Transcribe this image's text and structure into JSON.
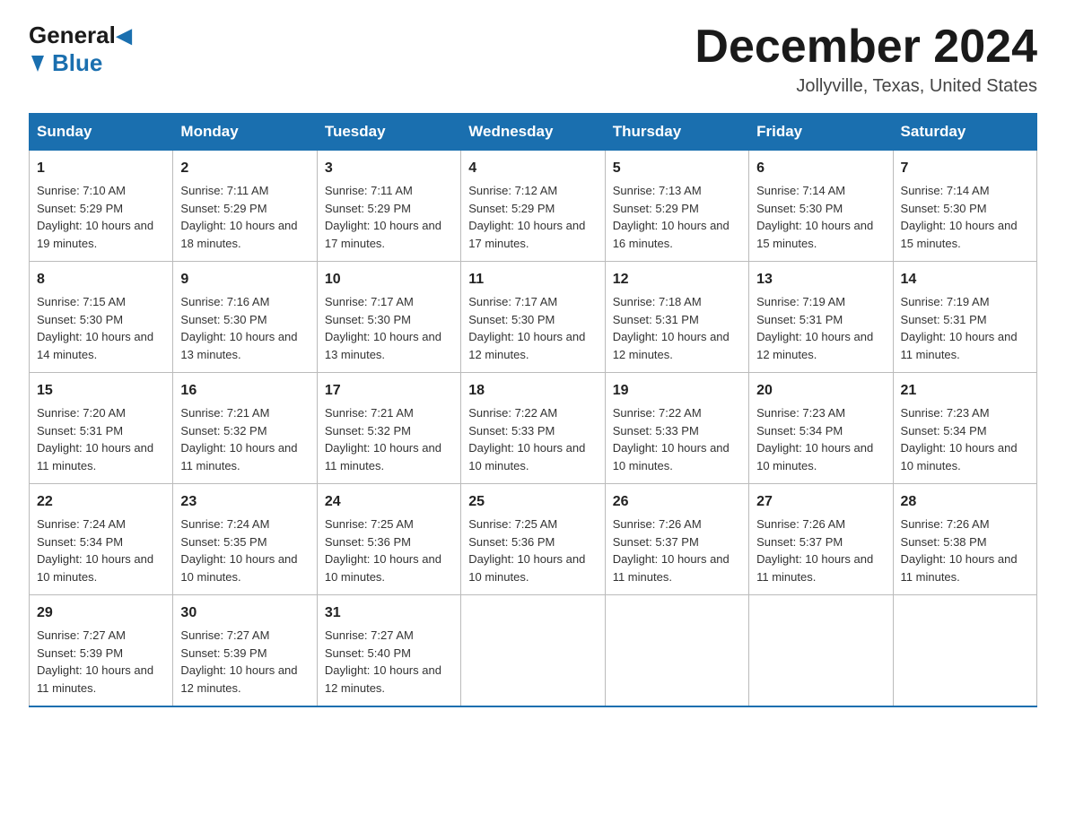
{
  "header": {
    "logo_general": "General",
    "logo_blue": "Blue",
    "title": "December 2024",
    "subtitle": "Jollyville, Texas, United States"
  },
  "weekdays": [
    "Sunday",
    "Monday",
    "Tuesday",
    "Wednesday",
    "Thursday",
    "Friday",
    "Saturday"
  ],
  "weeks": [
    [
      {
        "day": "1",
        "sunrise": "7:10 AM",
        "sunset": "5:29 PM",
        "daylight": "10 hours and 19 minutes."
      },
      {
        "day": "2",
        "sunrise": "7:11 AM",
        "sunset": "5:29 PM",
        "daylight": "10 hours and 18 minutes."
      },
      {
        "day": "3",
        "sunrise": "7:11 AM",
        "sunset": "5:29 PM",
        "daylight": "10 hours and 17 minutes."
      },
      {
        "day": "4",
        "sunrise": "7:12 AM",
        "sunset": "5:29 PM",
        "daylight": "10 hours and 17 minutes."
      },
      {
        "day": "5",
        "sunrise": "7:13 AM",
        "sunset": "5:29 PM",
        "daylight": "10 hours and 16 minutes."
      },
      {
        "day": "6",
        "sunrise": "7:14 AM",
        "sunset": "5:30 PM",
        "daylight": "10 hours and 15 minutes."
      },
      {
        "day": "7",
        "sunrise": "7:14 AM",
        "sunset": "5:30 PM",
        "daylight": "10 hours and 15 minutes."
      }
    ],
    [
      {
        "day": "8",
        "sunrise": "7:15 AM",
        "sunset": "5:30 PM",
        "daylight": "10 hours and 14 minutes."
      },
      {
        "day": "9",
        "sunrise": "7:16 AM",
        "sunset": "5:30 PM",
        "daylight": "10 hours and 13 minutes."
      },
      {
        "day": "10",
        "sunrise": "7:17 AM",
        "sunset": "5:30 PM",
        "daylight": "10 hours and 13 minutes."
      },
      {
        "day": "11",
        "sunrise": "7:17 AM",
        "sunset": "5:30 PM",
        "daylight": "10 hours and 12 minutes."
      },
      {
        "day": "12",
        "sunrise": "7:18 AM",
        "sunset": "5:31 PM",
        "daylight": "10 hours and 12 minutes."
      },
      {
        "day": "13",
        "sunrise": "7:19 AM",
        "sunset": "5:31 PM",
        "daylight": "10 hours and 12 minutes."
      },
      {
        "day": "14",
        "sunrise": "7:19 AM",
        "sunset": "5:31 PM",
        "daylight": "10 hours and 11 minutes."
      }
    ],
    [
      {
        "day": "15",
        "sunrise": "7:20 AM",
        "sunset": "5:31 PM",
        "daylight": "10 hours and 11 minutes."
      },
      {
        "day": "16",
        "sunrise": "7:21 AM",
        "sunset": "5:32 PM",
        "daylight": "10 hours and 11 minutes."
      },
      {
        "day": "17",
        "sunrise": "7:21 AM",
        "sunset": "5:32 PM",
        "daylight": "10 hours and 11 minutes."
      },
      {
        "day": "18",
        "sunrise": "7:22 AM",
        "sunset": "5:33 PM",
        "daylight": "10 hours and 10 minutes."
      },
      {
        "day": "19",
        "sunrise": "7:22 AM",
        "sunset": "5:33 PM",
        "daylight": "10 hours and 10 minutes."
      },
      {
        "day": "20",
        "sunrise": "7:23 AM",
        "sunset": "5:34 PM",
        "daylight": "10 hours and 10 minutes."
      },
      {
        "day": "21",
        "sunrise": "7:23 AM",
        "sunset": "5:34 PM",
        "daylight": "10 hours and 10 minutes."
      }
    ],
    [
      {
        "day": "22",
        "sunrise": "7:24 AM",
        "sunset": "5:34 PM",
        "daylight": "10 hours and 10 minutes."
      },
      {
        "day": "23",
        "sunrise": "7:24 AM",
        "sunset": "5:35 PM",
        "daylight": "10 hours and 10 minutes."
      },
      {
        "day": "24",
        "sunrise": "7:25 AM",
        "sunset": "5:36 PM",
        "daylight": "10 hours and 10 minutes."
      },
      {
        "day": "25",
        "sunrise": "7:25 AM",
        "sunset": "5:36 PM",
        "daylight": "10 hours and 10 minutes."
      },
      {
        "day": "26",
        "sunrise": "7:26 AM",
        "sunset": "5:37 PM",
        "daylight": "10 hours and 11 minutes."
      },
      {
        "day": "27",
        "sunrise": "7:26 AM",
        "sunset": "5:37 PM",
        "daylight": "10 hours and 11 minutes."
      },
      {
        "day": "28",
        "sunrise": "7:26 AM",
        "sunset": "5:38 PM",
        "daylight": "10 hours and 11 minutes."
      }
    ],
    [
      {
        "day": "29",
        "sunrise": "7:27 AM",
        "sunset": "5:39 PM",
        "daylight": "10 hours and 11 minutes."
      },
      {
        "day": "30",
        "sunrise": "7:27 AM",
        "sunset": "5:39 PM",
        "daylight": "10 hours and 12 minutes."
      },
      {
        "day": "31",
        "sunrise": "7:27 AM",
        "sunset": "5:40 PM",
        "daylight": "10 hours and 12 minutes."
      },
      null,
      null,
      null,
      null
    ]
  ],
  "labels": {
    "sunrise_prefix": "Sunrise: ",
    "sunset_prefix": "Sunset: ",
    "daylight_prefix": "Daylight: "
  }
}
